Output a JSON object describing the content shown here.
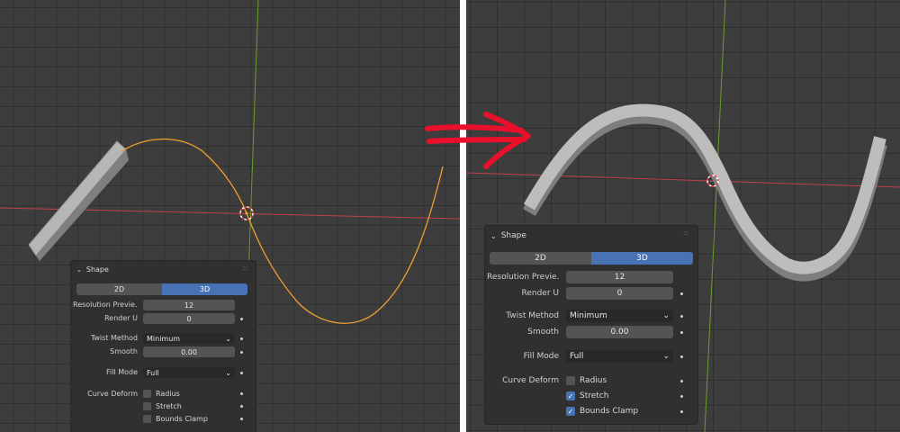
{
  "left": {
    "panel": {
      "title": "Shape",
      "mode_2d": "2D",
      "mode_3d": "3D",
      "resolution_preview": {
        "label": "Resolution Previe...",
        "value": "12"
      },
      "render_u": {
        "label": "Render U",
        "value": "0"
      },
      "twist_method": {
        "label": "Twist Method",
        "value": "Minimum"
      },
      "smooth": {
        "label": "Smooth",
        "value": "0.00"
      },
      "fill_mode": {
        "label": "Fill Mode",
        "value": "Full"
      },
      "curve_deform": {
        "label": "Curve Deform",
        "radius": {
          "label": "Radius",
          "checked": false
        },
        "stretch": {
          "label": "Stretch",
          "checked": false
        },
        "bounds_clamp": {
          "label": "Bounds Clamp",
          "checked": false
        }
      }
    }
  },
  "right": {
    "panel": {
      "title": "Shape",
      "mode_2d": "2D",
      "mode_3d": "3D",
      "resolution_preview": {
        "label": "Resolution Previe...",
        "value": "12"
      },
      "render_u": {
        "label": "Render U",
        "value": "0"
      },
      "twist_method": {
        "label": "Twist Method",
        "value": "Minimum"
      },
      "smooth": {
        "label": "Smooth",
        "value": "0.00"
      },
      "fill_mode": {
        "label": "Fill Mode",
        "value": "Full"
      },
      "curve_deform": {
        "label": "Curve Deform",
        "radius": {
          "label": "Radius",
          "checked": false
        },
        "stretch": {
          "label": "Stretch",
          "checked": true
        },
        "bounds_clamp": {
          "label": "Bounds Clamp",
          "checked": true
        }
      }
    }
  },
  "colors": {
    "viewport_bg": "#3d3d3d",
    "x_axis": "#c0404a",
    "y_axis": "#6e9a2e",
    "curve_selected": "#f0a030",
    "mesh": "#b8b8b8",
    "arrow": "#e8102a",
    "accent": "#4772b3"
  },
  "icons": [
    "chevron-down-icon",
    "grip-icon",
    "3d-cursor-icon",
    "checkmark-icon",
    "hand-drawn-arrow-icon"
  ]
}
